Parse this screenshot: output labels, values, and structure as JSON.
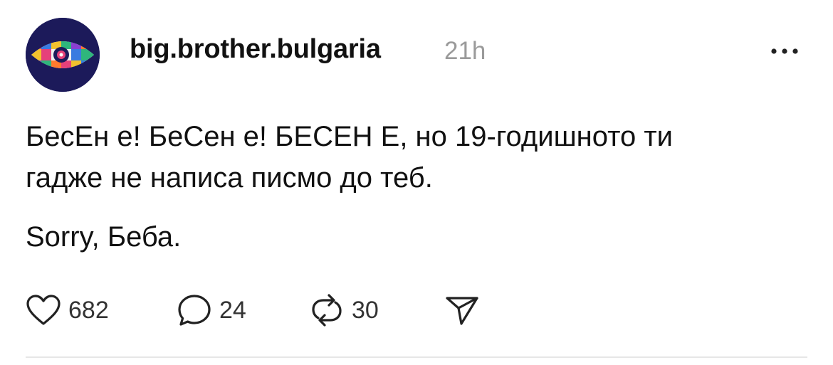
{
  "post": {
    "username": "big.brother.bulgaria",
    "timestamp": "21h",
    "text_line1": "БесЕн е! БеСен е! БЕСЕН Е, но 19-годишното ти",
    "text_line2": "гадже не написа писмо до теб.",
    "text_line3": "Sorry, Беба."
  },
  "actions": {
    "likes": "682",
    "comments": "24",
    "reposts": "30"
  },
  "icons": {
    "more": "more-horizontal-icon",
    "like": "heart-icon",
    "comment": "comment-bubble-icon",
    "repost": "repost-icon",
    "share": "send-icon"
  },
  "colors": {
    "avatar_bg": "#1c1a5a",
    "muted": "#9a9a9a",
    "icon": "#222222"
  }
}
